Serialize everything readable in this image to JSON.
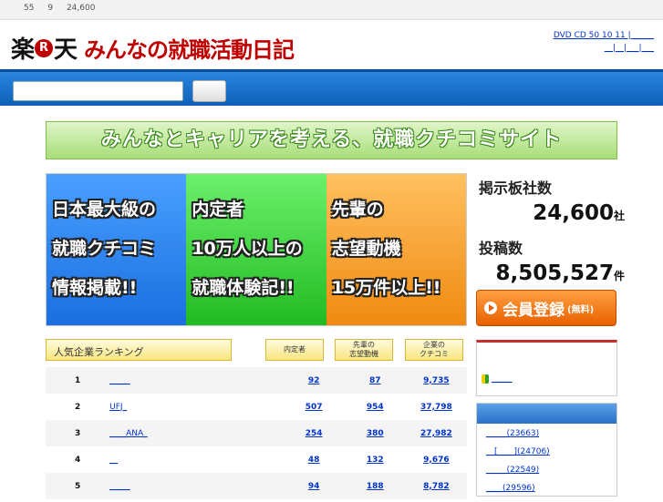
{
  "topbar": {
    "items": [
      "55",
      "9",
      "24,600"
    ]
  },
  "header": {
    "logo_raku": "楽",
    "logo_r": "R",
    "logo_ten": "天",
    "site_title": "みんなの就職活動日記",
    "links_line1": "DVD CD   50  10 11  | _____",
    "links_line2": "__|__|___|___"
  },
  "search": {
    "value": "",
    "button_label": ""
  },
  "banner": {
    "text": "みんなとキャリアを考える、就職クチコミサイト"
  },
  "hero": {
    "col1": [
      "日本最大級の",
      "就職クチコミ",
      "情報掲載!!"
    ],
    "col2": [
      "内定者",
      "10万人以上の",
      "就職体験記!!"
    ],
    "col3": [
      "先輩の",
      "志望動機",
      "15万件以上!!"
    ]
  },
  "stats": {
    "board_label": "掲示板社数",
    "board_count": "24,600",
    "board_unit": "社",
    "posts_label": "投稿数",
    "posts_count": "8,505,527",
    "posts_unit": "件"
  },
  "register": {
    "label": "会員登録",
    "note": "(無料)"
  },
  "ranking": {
    "title": "人気企業ランキング",
    "col_headers": [
      "内定者",
      "先輩の\n志望動機",
      "企業の\nクチコミ"
    ],
    "rows": [
      {
        "rank": "1",
        "name": "_____",
        "a": "92",
        "b": "87",
        "c": "9,735"
      },
      {
        "rank": "2",
        "name": "UFJ_",
        "a": "507",
        "b": "954",
        "c": "37,798"
      },
      {
        "rank": "3",
        "name": "____ANA_",
        "a": "254",
        "b": "380",
        "c": "27,982"
      },
      {
        "rank": "4",
        "name": "__",
        "a": "48",
        "b": "132",
        "c": "9,676"
      },
      {
        "rank": "5",
        "name": "_____",
        "a": "94",
        "b": "188",
        "c": "8,782"
      }
    ]
  },
  "sidebar": {
    "beginner_link": "_____",
    "links": [
      "_____(23663)",
      "__[____](24706)",
      "_____(22549)",
      "____(29596)"
    ]
  },
  "colors": {
    "brand_red": "#bf0000",
    "nav_blue": "#1a6ec8",
    "accent_orange": "#e86000"
  }
}
